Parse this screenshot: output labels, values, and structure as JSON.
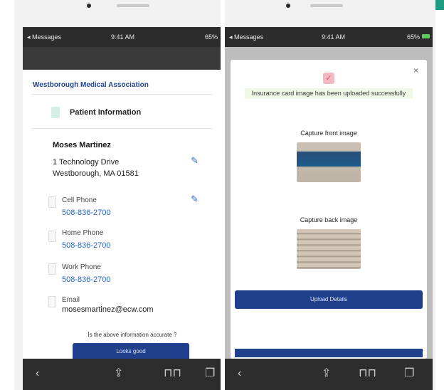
{
  "left_phone": {
    "status": {
      "carrier": "◂ Messages",
      "time": "9:41 AM",
      "battery": "65%"
    },
    "org_name": "Westborough Medical Association",
    "section_title": "Patient Information",
    "patient_name": "Moses Martinez",
    "address_line1": "1 Technology Drive",
    "address_line2": "Westborough, MA 01581",
    "fields": [
      {
        "label": "Cell Phone",
        "value": "508-836-2700"
      },
      {
        "label": "Home Phone",
        "value": "508-836-2700"
      },
      {
        "label": "Work Phone",
        "value": "508-836-2700"
      },
      {
        "label": "Email",
        "value": "mosesmartinez@ecw.com"
      }
    ],
    "question": "Is the above information accurate ?",
    "confirm_button": "Looks good"
  },
  "right_phone": {
    "status": {
      "carrier": "◂ Messages",
      "time": "9:41 AM",
      "battery": "65%"
    },
    "success_message": "Insurance card image has been uploaded successfully",
    "front_label": "Capture front image",
    "back_label": "Capture back image",
    "upload_button": "Upload Details"
  },
  "icons": {
    "edit": "pencil-icon",
    "close": "close-icon",
    "success": "id-card-icon",
    "back": "chevron-left-icon",
    "share": "share-icon",
    "bookmarks": "book-icon",
    "tabs": "tabs-icon"
  },
  "colors": {
    "brand_blue": "#21468f",
    "button_blue": "#203f8c",
    "link_blue": "#2d66b7",
    "accent_green": "#1f9a82"
  }
}
